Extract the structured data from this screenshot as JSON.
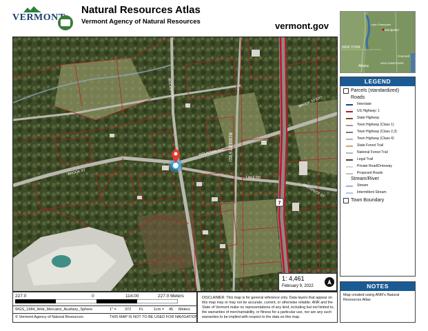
{
  "header": {
    "vt_logo": "VERMONT",
    "title": "Natural Resources Atlas",
    "subtitle": "Vermont Agency of Natural Resources",
    "site": "vermont.gov"
  },
  "map": {
    "road_labels": [
      "ROCKWOOD",
      "MOUNTAIN AVE",
      "BROOK ST EXT",
      "ROBERTS RD",
      "LAKE RD",
      "PROSPECT ST",
      "BROOK ST"
    ],
    "route_shield": "7",
    "scale_text": "1: 4,461",
    "date": "February 9, 2022"
  },
  "inset": {
    "labels": [
      "Lake Champlain",
      "Montpelier",
      "NEW YORK",
      "Concord",
      "Albany",
      "NEW HAMPSHIRE"
    ]
  },
  "legend": {
    "title": "LEGEND",
    "parcels_label": "Parcels (standardized)",
    "roads_heading": "Roads",
    "roads": [
      {
        "label": "Interstate",
        "color": "#1c3f8c"
      },
      {
        "label": "US Highway; 1",
        "color": "#c8102e"
      },
      {
        "label": "State Highway",
        "color": "#7a4a1e"
      },
      {
        "label": "Town Highway (Class 1)",
        "color": "#9a9a9a"
      },
      {
        "label": "Town Highway (Class 2,3)",
        "color": "#7a7a7a"
      },
      {
        "label": "Town Highway (Class 4)",
        "color": "#b0b0b0"
      },
      {
        "label": "State Forest Trail",
        "color": "#c9a27a"
      },
      {
        "label": "National Forest Trail",
        "color": "#b5b5b5"
      },
      {
        "label": "Legal Trail",
        "color": "#5a3a1e"
      },
      {
        "label": "Private Road/Driveway",
        "color": "#d0d0d0"
      },
      {
        "label": "Proposed Roads",
        "color": "#c0c0c0"
      }
    ],
    "stream_heading": "Stream/River",
    "streams": [
      {
        "label": "Stream",
        "color": "#8fb4d9"
      },
      {
        "label": "Intermittent Stream",
        "color": "#a9c6e0"
      }
    ],
    "town_boundary_label": "Town Boundary"
  },
  "notes": {
    "title": "NOTES",
    "text": "Map created using ANR's Natural Resources Atlas"
  },
  "scalebar": {
    "left_value": "227.0",
    "zero": "0",
    "mid_value": "114.00",
    "right_value": "227.0 Meters",
    "projection": "WGS_1984_Web_Mercator_Auxiliary_Sphere",
    "ratio_in": "1\" =",
    "ratio_in_value": "372",
    "ratio_in_unit": "Ft.",
    "ratio_cm": "1cm =",
    "ratio_cm_value": "45",
    "ratio_cm_unit": "Meters",
    "copyright": "© Vermont Agency of Natural Resources",
    "nav_warning": "THIS MAP IS NOT TO BE USED FOR NAVIGATION"
  },
  "disclaimer": {
    "text": "DISCLAIMER: This map is for general reference only. Data layers that appear on this map may or may not be accurate, current, or otherwise reliable. ANR and the State of Vermont make no representations of any kind, including but not limited to, the warranties of merchantability, or fitness for a particular use, nor are any such warranties to be implied with respect to the data on this map."
  },
  "colors": {
    "accent": "#1a5b94",
    "parcel_line": "#b8211f",
    "highway": "#c8102e"
  }
}
